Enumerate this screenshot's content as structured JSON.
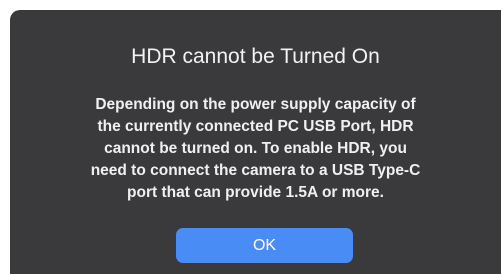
{
  "dialog": {
    "title": "HDR cannot be Turned On",
    "message_lines": [
      "Depending on the power supply capacity of",
      "the currently connected PC USB Port, HDR",
      "cannot be turned on. To enable HDR, you",
      "need to connect the camera to a USB Type-C",
      "port that can provide 1.5A or more."
    ],
    "ok_label": "OK"
  },
  "colors": {
    "dialog_background": "#3a3a3c",
    "button_accent": "#4a8cf6",
    "page_background": "#ffffff"
  }
}
